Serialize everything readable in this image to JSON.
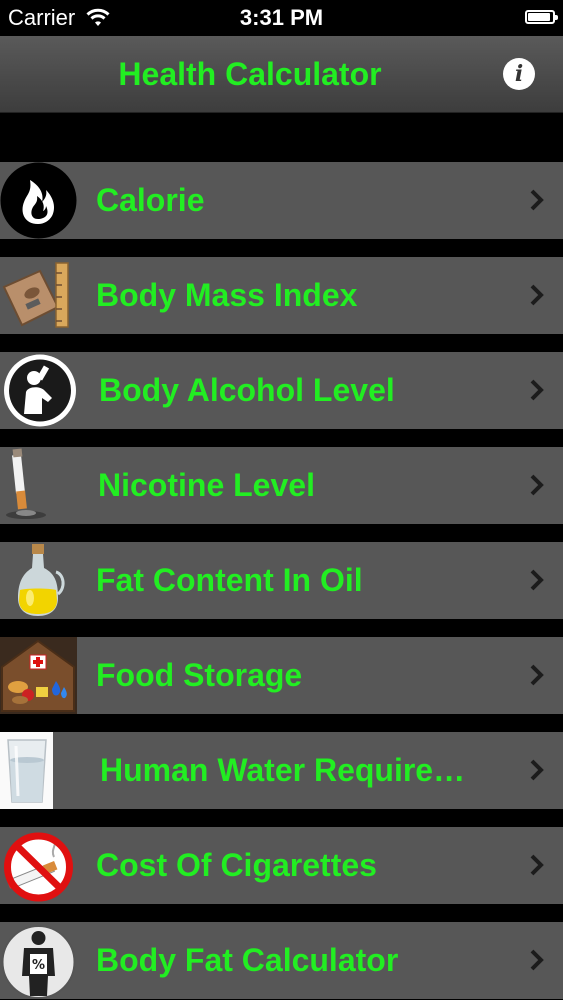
{
  "status_bar": {
    "carrier": "Carrier",
    "time": "3:31 PM",
    "battery_level": 0.9
  },
  "header": {
    "title": "Health Calculator",
    "info_label": "i"
  },
  "menu": {
    "items": [
      {
        "label": "Calorie",
        "icon": "flame-icon"
      },
      {
        "label": "Body Mass Index",
        "icon": "scale-ruler-icon"
      },
      {
        "label": "Body Alcohol Level",
        "icon": "drinking-person-icon"
      },
      {
        "label": "Nicotine Level",
        "icon": "cigarette-icon"
      },
      {
        "label": "Fat Content In Oil",
        "icon": "oil-bottle-icon"
      },
      {
        "label": "Food Storage",
        "icon": "food-storage-icon"
      },
      {
        "label": "Human Water Require…",
        "icon": "water-glass-icon"
      },
      {
        "label": "Cost Of Cigarettes",
        "icon": "no-smoking-icon"
      },
      {
        "label": "Body Fat Calculator",
        "icon": "body-fat-person-icon"
      }
    ]
  },
  "colors": {
    "accent": "#22ee22",
    "row_bg": "#575757",
    "background": "#000000"
  }
}
